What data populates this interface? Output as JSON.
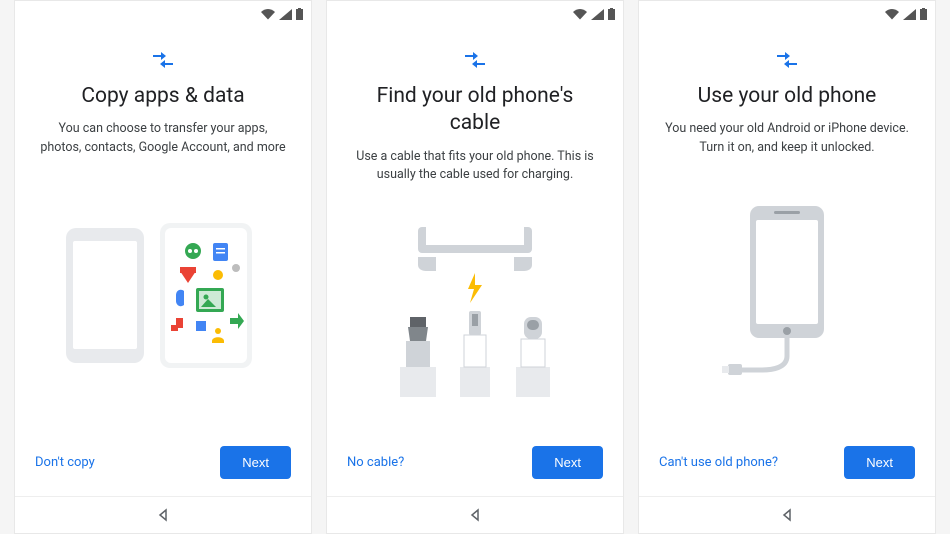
{
  "screens": [
    {
      "title": "Copy apps & data",
      "subtitle": "You can choose to transfer your apps, photos, contacts, Google Account, and more",
      "secondary_link": "Don't copy",
      "next_label": "Next"
    },
    {
      "title": "Find your old phone's cable",
      "subtitle": "Use a cable that fits your old phone. This is usually the cable used for charging.",
      "secondary_link": "No cable?",
      "next_label": "Next"
    },
    {
      "title": "Use your old phone",
      "subtitle": "You need your old Android or iPhone device. Turn it on, and keep it unlocked.",
      "secondary_link": "Can't use old phone?",
      "next_label": "Next"
    }
  ],
  "icons": {
    "wifi": "wifi-icon",
    "signal": "signal-icon",
    "battery": "battery-icon"
  }
}
